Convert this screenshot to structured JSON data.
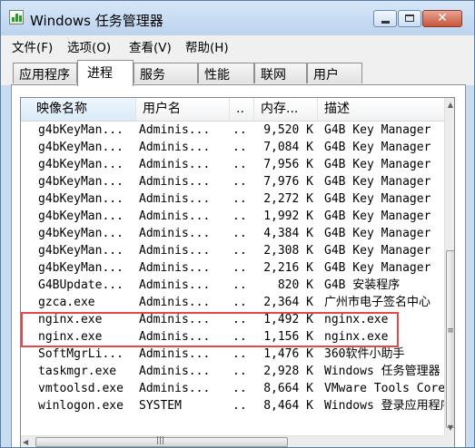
{
  "window": {
    "title": "Windows 任务管理器"
  },
  "menu": [
    "文件(F)",
    "选项(O)",
    "查看(V)",
    "帮助(H)"
  ],
  "tabs": [
    {
      "label": "应用程序",
      "active": false
    },
    {
      "label": "进程",
      "active": true
    },
    {
      "label": "服务",
      "active": false
    },
    {
      "label": "性能",
      "active": false
    },
    {
      "label": "联网",
      "active": false
    },
    {
      "label": "用户",
      "active": false
    }
  ],
  "columns": {
    "name": "映像名称",
    "user": "用户名",
    "cpu": "..",
    "memory": "内存...",
    "description": "描述"
  },
  "processes": [
    {
      "name": "g4bKeyMan...",
      "user": "Adminis...",
      "cpu": "..",
      "memory": "9,520 K",
      "description": "G4B Key Manager"
    },
    {
      "name": "g4bKeyMan...",
      "user": "Adminis...",
      "cpu": "..",
      "memory": "7,084 K",
      "description": "G4B Key Manager"
    },
    {
      "name": "g4bKeyMan...",
      "user": "Adminis...",
      "cpu": "..",
      "memory": "7,956 K",
      "description": "G4B Key Manager"
    },
    {
      "name": "g4bKeyMan...",
      "user": "Adminis...",
      "cpu": "..",
      "memory": "7,976 K",
      "description": "G4B Key Manager"
    },
    {
      "name": "g4bKeyMan...",
      "user": "Adminis...",
      "cpu": "..",
      "memory": "2,272 K",
      "description": "G4B Key Manager"
    },
    {
      "name": "g4bKeyMan...",
      "user": "Adminis...",
      "cpu": "..",
      "memory": "1,992 K",
      "description": "G4B Key Manager"
    },
    {
      "name": "g4bKeyMan...",
      "user": "Adminis...",
      "cpu": "..",
      "memory": "4,384 K",
      "description": "G4B Key Manager"
    },
    {
      "name": "g4bKeyMan...",
      "user": "Adminis...",
      "cpu": "..",
      "memory": "2,308 K",
      "description": "G4B Key Manager"
    },
    {
      "name": "g4bKeyMan...",
      "user": "Adminis...",
      "cpu": "..",
      "memory": "2,216 K",
      "description": "G4B Key Manager"
    },
    {
      "name": "G4BUpdate...",
      "user": "Adminis...",
      "cpu": "..",
      "memory": "820 K",
      "description": "G4B 安装程序"
    },
    {
      "name": "gzca.exe",
      "user": "Adminis...",
      "cpu": "..",
      "memory": "2,364 K",
      "description": "广州市电子签名中心"
    },
    {
      "name": "nginx.exe",
      "user": "Adminis...",
      "cpu": "..",
      "memory": "1,492 K",
      "description": "nginx.exe"
    },
    {
      "name": "nginx.exe",
      "user": "Adminis...",
      "cpu": "..",
      "memory": "1,156 K",
      "description": "nginx.exe"
    },
    {
      "name": "SoftMgrLi...",
      "user": "Adminis...",
      "cpu": "..",
      "memory": "1,476 K",
      "description": "360软件小助手"
    },
    {
      "name": "taskmgr.exe",
      "user": "Adminis...",
      "cpu": "..",
      "memory": "2,928 K",
      "description": "Windows 任务管理器"
    },
    {
      "name": "vmtoolsd.exe",
      "user": "Adminis...",
      "cpu": "..",
      "memory": "8,664 K",
      "description": "VMware Tools Core"
    },
    {
      "name": "winlogon.exe",
      "user": "SYSTEM",
      "cpu": "..",
      "memory": "8,464 K",
      "description": "Windows 登录应用程序"
    }
  ],
  "icons": {
    "app": "task-manager-icon",
    "minimize": "minimize-icon",
    "maximize": "maximize-icon",
    "close": "close-icon",
    "sort": "sort-ascending-icon",
    "scroll_up": "scroll-up-arrow-icon",
    "scroll_down": "scroll-down-arrow-icon",
    "scroll_left": "scroll-left-arrow-icon"
  },
  "colors": {
    "highlight": "#e24a4a",
    "title_bar": "#c7dbf1"
  }
}
